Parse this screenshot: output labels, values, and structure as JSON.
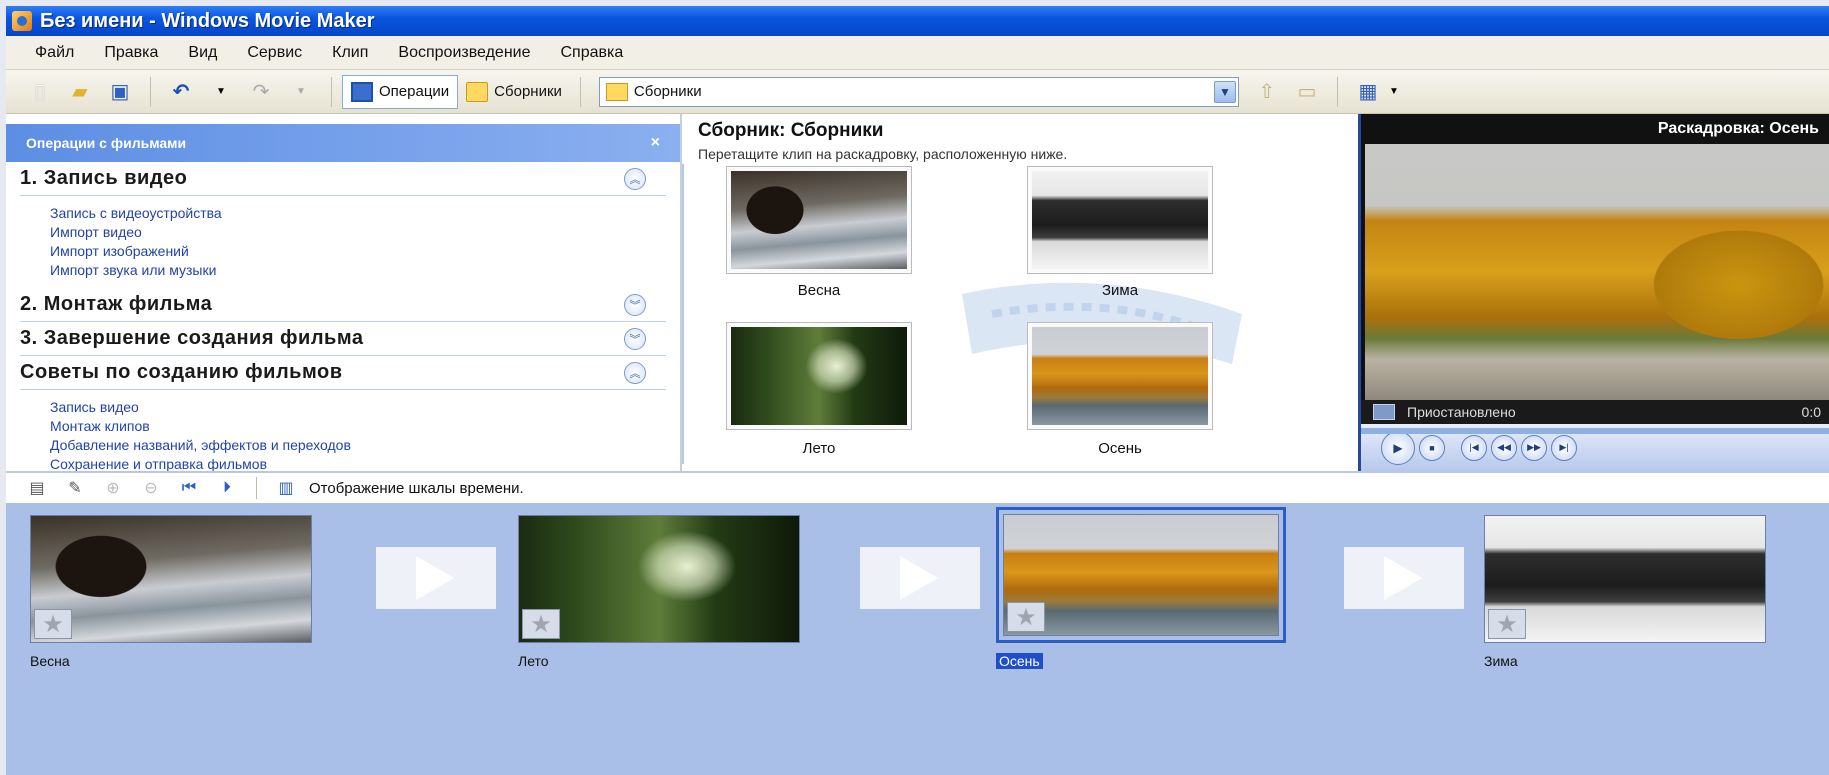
{
  "window": {
    "title": "Без имени - Windows Movie Maker"
  },
  "menu": [
    "Файл",
    "Правка",
    "Вид",
    "Сервис",
    "Клип",
    "Воспроизведение",
    "Справка"
  ],
  "toolbar": {
    "operations_label": "Операции",
    "collections_label": "Сборники",
    "collection_combo_value": "Сборники"
  },
  "tasks": {
    "header": "Операции с фильмами",
    "sections": [
      {
        "title": "1. Запись видео",
        "links": [
          "Запись с видеоустройства",
          "Импорт видео",
          "Импорт изображений",
          "Импорт звука или музыки"
        ]
      },
      {
        "title": "2. Монтаж фильма",
        "links": []
      },
      {
        "title": "3. Завершение создания фильма",
        "links": []
      },
      {
        "title": "Советы по созданию фильмов",
        "links": [
          "Запись видео",
          "Монтаж клипов",
          "Добавление названий, эффектов и переходов",
          "Сохранение и отправка фильмов"
        ]
      }
    ]
  },
  "collection": {
    "title": "Сборник: Сборники",
    "description": "Перетащите клип на раскадровку, расположенную ниже.",
    "clips": [
      "Весна",
      "Зима",
      "Лето",
      "Осень"
    ]
  },
  "monitor": {
    "title": "Раскадровка: Осень",
    "status": "Приостановлено",
    "time": "0:0"
  },
  "storyboard": {
    "toolbar_label": "Отображение шкалы времени.",
    "clips": [
      "Весна",
      "Лето",
      "Осень",
      "Зима"
    ],
    "selected_index": 2
  },
  "colors": {
    "titlebar": "#0a55e0",
    "storyboard_bg": "#a9bfe8",
    "link": "#2244aa"
  }
}
